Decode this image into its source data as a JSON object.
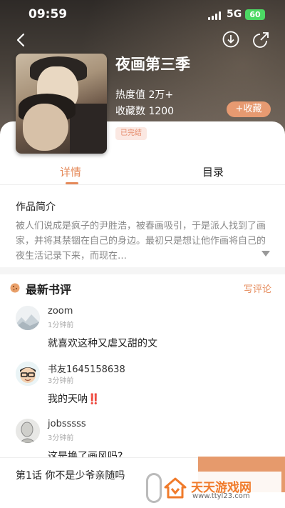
{
  "status_bar": {
    "time": "09:59",
    "network": "5G",
    "battery": "60"
  },
  "comic": {
    "title": "夜画第三季",
    "heat": "热度值 2万+",
    "favorites": "收藏数 1200",
    "favorite_button": "+收藏",
    "status_badge": "已完结"
  },
  "tabs": [
    {
      "label": "详情",
      "active": true
    },
    {
      "label": "目录",
      "active": false
    }
  ],
  "intro": {
    "heading": "作品简介",
    "text": "被人们说成是疯子的尹胜浩，被春画吸引，于是派人找到了画家，并将其禁锢在自己的身边。最初只是想让他作画将自己的夜生活记录下来，而现在…"
  },
  "reviews": {
    "heading": "最新书评",
    "write_label": "写评论",
    "items": [
      {
        "user": "zoom",
        "time": "1分钟前",
        "text": "就喜欢这种又虐又甜的文",
        "avatar": "landscape-avatar"
      },
      {
        "user": "书友1645158638",
        "time": "3分钟前",
        "text": "我的天呐‼️",
        "avatar": "cartoon-glasses-avatar"
      },
      {
        "user": "jobsssss",
        "time": "3分钟前",
        "text": "这是换了画风吗?",
        "avatar": "sketch-portrait-avatar"
      }
    ]
  },
  "bottom_bar": {
    "chapter": "第1话 你不是少爷亲随吗"
  },
  "watermark": {
    "title": "天天游戏网",
    "url": "www.ttyl23.com"
  },
  "colors": {
    "accent": "#e58a5a",
    "button": "#e79a71",
    "badge_bg": "#fbe8e2"
  }
}
